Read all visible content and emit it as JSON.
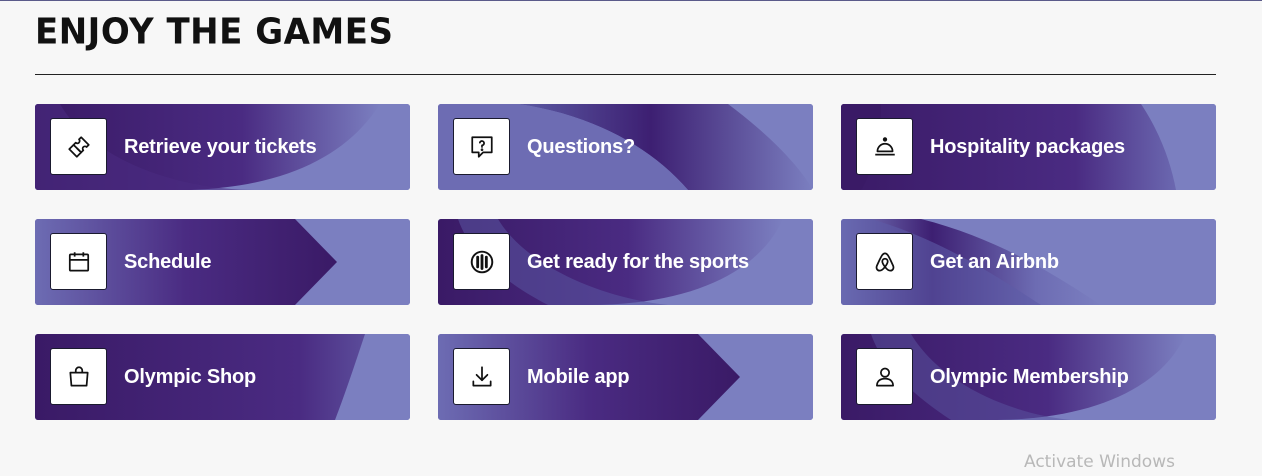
{
  "heading": "ENJOY THE GAMES",
  "colors": {
    "dark_purple": "#3a1a66",
    "mid_purple": "#4a2b82",
    "light_purple": "#7b7fc0"
  },
  "cards": [
    {
      "label": "Retrieve your tickets",
      "icon": "ticket-icon"
    },
    {
      "label": "Questions?",
      "icon": "question-bubble-icon"
    },
    {
      "label": "Hospitality packages",
      "icon": "service-bell-icon"
    },
    {
      "label": "Schedule",
      "icon": "calendar-icon"
    },
    {
      "label": "Get ready for the sports",
      "icon": "sports-pictogram-icon"
    },
    {
      "label": "Get an Airbnb",
      "icon": "airbnb-icon"
    },
    {
      "label": "Olympic Shop",
      "icon": "shopping-bag-icon"
    },
    {
      "label": "Mobile app",
      "icon": "download-icon"
    },
    {
      "label": "Olympic Membership",
      "icon": "user-icon"
    }
  ],
  "watermark": "Activate Windows"
}
